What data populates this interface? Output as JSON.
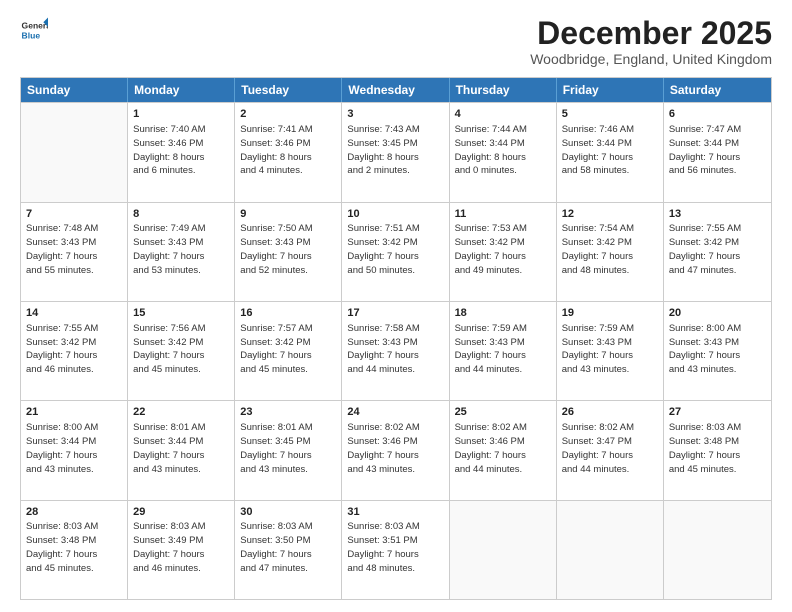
{
  "logo": {
    "general": "General",
    "blue": "Blue"
  },
  "title": "December 2025",
  "subtitle": "Woodbridge, England, United Kingdom",
  "days": [
    "Sunday",
    "Monday",
    "Tuesday",
    "Wednesday",
    "Thursday",
    "Friday",
    "Saturday"
  ],
  "rows": [
    [
      {
        "day": "",
        "text": ""
      },
      {
        "day": "1",
        "text": "Sunrise: 7:40 AM\nSunset: 3:46 PM\nDaylight: 8 hours\nand 6 minutes."
      },
      {
        "day": "2",
        "text": "Sunrise: 7:41 AM\nSunset: 3:46 PM\nDaylight: 8 hours\nand 4 minutes."
      },
      {
        "day": "3",
        "text": "Sunrise: 7:43 AM\nSunset: 3:45 PM\nDaylight: 8 hours\nand 2 minutes."
      },
      {
        "day": "4",
        "text": "Sunrise: 7:44 AM\nSunset: 3:44 PM\nDaylight: 8 hours\nand 0 minutes."
      },
      {
        "day": "5",
        "text": "Sunrise: 7:46 AM\nSunset: 3:44 PM\nDaylight: 7 hours\nand 58 minutes."
      },
      {
        "day": "6",
        "text": "Sunrise: 7:47 AM\nSunset: 3:44 PM\nDaylight: 7 hours\nand 56 minutes."
      }
    ],
    [
      {
        "day": "7",
        "text": "Sunrise: 7:48 AM\nSunset: 3:43 PM\nDaylight: 7 hours\nand 55 minutes."
      },
      {
        "day": "8",
        "text": "Sunrise: 7:49 AM\nSunset: 3:43 PM\nDaylight: 7 hours\nand 53 minutes."
      },
      {
        "day": "9",
        "text": "Sunrise: 7:50 AM\nSunset: 3:43 PM\nDaylight: 7 hours\nand 52 minutes."
      },
      {
        "day": "10",
        "text": "Sunrise: 7:51 AM\nSunset: 3:42 PM\nDaylight: 7 hours\nand 50 minutes."
      },
      {
        "day": "11",
        "text": "Sunrise: 7:53 AM\nSunset: 3:42 PM\nDaylight: 7 hours\nand 49 minutes."
      },
      {
        "day": "12",
        "text": "Sunrise: 7:54 AM\nSunset: 3:42 PM\nDaylight: 7 hours\nand 48 minutes."
      },
      {
        "day": "13",
        "text": "Sunrise: 7:55 AM\nSunset: 3:42 PM\nDaylight: 7 hours\nand 47 minutes."
      }
    ],
    [
      {
        "day": "14",
        "text": "Sunrise: 7:55 AM\nSunset: 3:42 PM\nDaylight: 7 hours\nand 46 minutes."
      },
      {
        "day": "15",
        "text": "Sunrise: 7:56 AM\nSunset: 3:42 PM\nDaylight: 7 hours\nand 45 minutes."
      },
      {
        "day": "16",
        "text": "Sunrise: 7:57 AM\nSunset: 3:42 PM\nDaylight: 7 hours\nand 45 minutes."
      },
      {
        "day": "17",
        "text": "Sunrise: 7:58 AM\nSunset: 3:43 PM\nDaylight: 7 hours\nand 44 minutes."
      },
      {
        "day": "18",
        "text": "Sunrise: 7:59 AM\nSunset: 3:43 PM\nDaylight: 7 hours\nand 44 minutes."
      },
      {
        "day": "19",
        "text": "Sunrise: 7:59 AM\nSunset: 3:43 PM\nDaylight: 7 hours\nand 43 minutes."
      },
      {
        "day": "20",
        "text": "Sunrise: 8:00 AM\nSunset: 3:43 PM\nDaylight: 7 hours\nand 43 minutes."
      }
    ],
    [
      {
        "day": "21",
        "text": "Sunrise: 8:00 AM\nSunset: 3:44 PM\nDaylight: 7 hours\nand 43 minutes."
      },
      {
        "day": "22",
        "text": "Sunrise: 8:01 AM\nSunset: 3:44 PM\nDaylight: 7 hours\nand 43 minutes."
      },
      {
        "day": "23",
        "text": "Sunrise: 8:01 AM\nSunset: 3:45 PM\nDaylight: 7 hours\nand 43 minutes."
      },
      {
        "day": "24",
        "text": "Sunrise: 8:02 AM\nSunset: 3:46 PM\nDaylight: 7 hours\nand 43 minutes."
      },
      {
        "day": "25",
        "text": "Sunrise: 8:02 AM\nSunset: 3:46 PM\nDaylight: 7 hours\nand 44 minutes."
      },
      {
        "day": "26",
        "text": "Sunrise: 8:02 AM\nSunset: 3:47 PM\nDaylight: 7 hours\nand 44 minutes."
      },
      {
        "day": "27",
        "text": "Sunrise: 8:03 AM\nSunset: 3:48 PM\nDaylight: 7 hours\nand 45 minutes."
      }
    ],
    [
      {
        "day": "28",
        "text": "Sunrise: 8:03 AM\nSunset: 3:48 PM\nDaylight: 7 hours\nand 45 minutes."
      },
      {
        "day": "29",
        "text": "Sunrise: 8:03 AM\nSunset: 3:49 PM\nDaylight: 7 hours\nand 46 minutes."
      },
      {
        "day": "30",
        "text": "Sunrise: 8:03 AM\nSunset: 3:50 PM\nDaylight: 7 hours\nand 47 minutes."
      },
      {
        "day": "31",
        "text": "Sunrise: 8:03 AM\nSunset: 3:51 PM\nDaylight: 7 hours\nand 48 minutes."
      },
      {
        "day": "",
        "text": ""
      },
      {
        "day": "",
        "text": ""
      },
      {
        "day": "",
        "text": ""
      }
    ]
  ]
}
